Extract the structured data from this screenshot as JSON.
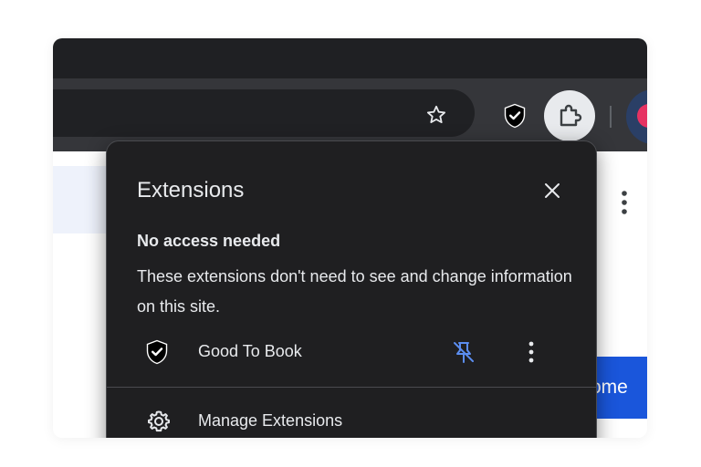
{
  "popup": {
    "title": "Extensions",
    "section_heading": "No access needed",
    "section_description": "These extensions don't need to see and change information on this site.",
    "extension": {
      "name": "Good To Book",
      "icon": "shield-check-icon",
      "pin_state": "unpinned"
    },
    "manage_label": "Manage Extensions"
  },
  "page": {
    "cta_label": "ome"
  },
  "toolbar": {
    "icons": [
      "star-icon",
      "shield-check-icon",
      "puzzle-icon",
      "avatar"
    ]
  },
  "colors": {
    "popup_bg": "#1f1f21",
    "toolbar_bg": "#35363a",
    "pin_icon": "#5b8def",
    "cta_bg": "#1a56db",
    "avatar_accent": "#e63262"
  }
}
